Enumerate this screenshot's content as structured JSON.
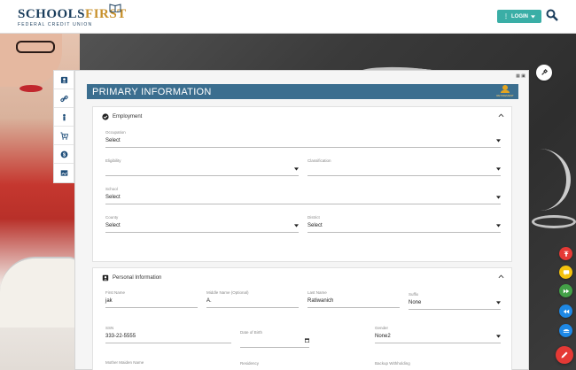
{
  "header": {
    "logo_main_prefix": "SCHOOLS",
    "logo_main_suffix": "FIRST",
    "logo_sub": "FEDERAL CREDIT UNION",
    "login_label": "LOGIN"
  },
  "panel": {
    "title": "PRIMARY INFORMATION",
    "badge_text": "RETIREMENT"
  },
  "employment": {
    "heading": "Employment",
    "fields": {
      "occupation": {
        "label": "Occupation",
        "value": "Select"
      },
      "eligibility": {
        "label": "Eligibility",
        "value": ""
      },
      "classification": {
        "label": "Classification",
        "value": ""
      },
      "school": {
        "label": "School",
        "value": "Select"
      },
      "county": {
        "label": "County",
        "value": "Select"
      },
      "district": {
        "label": "District",
        "value": "Select"
      }
    }
  },
  "personal": {
    "heading": "Personal Information",
    "fields": {
      "first_name": {
        "label": "First Name",
        "value": "jak"
      },
      "middle_name": {
        "label": "Middle Name (Optional)",
        "value": "A."
      },
      "last_name": {
        "label": "Last Name",
        "value": "Ratiwanich"
      },
      "suffix": {
        "label": "Suffix",
        "value": "None"
      },
      "ssn": {
        "label": "SSN",
        "value": "333-22-5555"
      },
      "dob": {
        "label": "Date of Birth",
        "value": ""
      },
      "gender": {
        "label": "Gender",
        "value": "None2"
      },
      "mother_maiden": {
        "label": "Mother Maiden Name",
        "value": ""
      },
      "residency": {
        "label": "Residency",
        "value": ""
      },
      "backup_withholding": {
        "label": "Backup Withholding",
        "value": ""
      }
    }
  },
  "colors": {
    "brand_navy": "#1a3d5c",
    "brand_gold": "#c8912c",
    "login_teal": "#3aaea6",
    "title_bar": "#3b6e8f"
  },
  "fabs": [
    {
      "icon": "upload-icon",
      "color": "#e53935"
    },
    {
      "icon": "chat-icon",
      "color": "#f4c20d"
    },
    {
      "icon": "fast-forward-icon",
      "color": "#43a047"
    },
    {
      "icon": "rewind-icon",
      "color": "#1e88e5"
    },
    {
      "icon": "layers-icon",
      "color": "#1e88e5"
    },
    {
      "icon": "pencil-icon",
      "color": "#e53935"
    }
  ]
}
